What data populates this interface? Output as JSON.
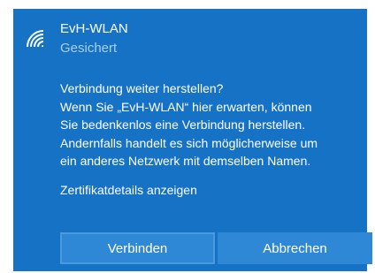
{
  "network": {
    "ssid": "EvH-WLAN",
    "status": "Gesichert",
    "icon": "wifi-secured-icon"
  },
  "message": {
    "lines": [
      "Verbindung weiter herstellen?",
      "Wenn Sie „EvH-WLAN“ hier erwarten, können",
      "Sie bedenkenlos eine Verbindung herstellen.",
      "Andernfalls handelt es sich möglicherweise um",
      "ein anderes Netzwerk mit demselben Namen."
    ]
  },
  "links": {
    "certificate_details": "Zertifikatdetails anzeigen"
  },
  "buttons": {
    "connect": "Verbinden",
    "cancel": "Abbrechen"
  },
  "colors": {
    "panel_background": "#1672c4",
    "button_background": "#2f88d6",
    "secondary_text": "#a9cdee"
  }
}
